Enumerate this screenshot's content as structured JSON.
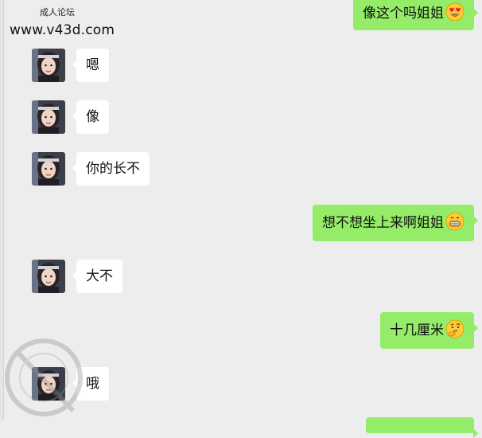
{
  "watermark": {
    "site_name": "成人论坛",
    "url": "www.v43d.com"
  },
  "messages": [
    {
      "side": "out",
      "text": "像这个吗姐姐",
      "emoji": "heart-eyes-emoji"
    },
    {
      "side": "in",
      "text": "嗯"
    },
    {
      "side": "in",
      "text": "像"
    },
    {
      "side": "in",
      "text": "你的长不"
    },
    {
      "side": "out",
      "text": "想不想坐上来啊姐姐",
      "emoji": "grinning-teeth-emoji"
    },
    {
      "side": "in",
      "text": "大不"
    },
    {
      "side": "out",
      "text": "十几厘米",
      "emoji": "thinking-emoji"
    },
    {
      "side": "in",
      "text": "哦"
    }
  ],
  "colors": {
    "background": "#ededed",
    "incoming_bubble": "#ffffff",
    "outgoing_bubble": "#95ec69",
    "text": "#111111"
  }
}
